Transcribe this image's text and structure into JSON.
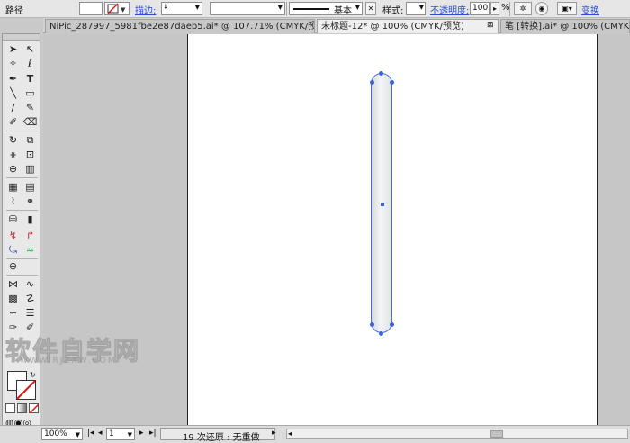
{
  "control_bar": {
    "path_label": "路径",
    "stroke_label": "描边:",
    "stroke_weight_value": "",
    "brush_label": "基本",
    "style_label": "样式:",
    "opacity_label": "不透明度:",
    "opacity_value": "100",
    "opacity_unit": "%",
    "transform_label": "变换"
  },
  "tabs": [
    {
      "label": "NiPic_287997_5981fbe2e87daeb5.ai* @ 107.71% (CMYK/预览)",
      "active": false
    },
    {
      "label": "未标题-12* @ 100% (CMYK/预览)",
      "active": true
    },
    {
      "label": "笔 [转换].ai* @ 100% (CMYK/预览)",
      "active": false
    }
  ],
  "watermark": {
    "main": "软件自学网",
    "sub": "WWW.RJZXW.COM"
  },
  "status_bar": {
    "zoom_value": "100%",
    "page_value": "1",
    "history_text": "19 次还原 : 无重做"
  },
  "colors": {
    "selection": "#3d63d6",
    "link": "#2a4fd6",
    "artboard": "#ffffff",
    "pasteboard": "#c6c6c6"
  },
  "icons": {
    "tools": [
      "selection-arrow",
      "direct-selection-arrow",
      "magic-wand",
      "lasso",
      "pen",
      "type",
      "line-segment",
      "rectangle",
      "paintbrush",
      "pencil",
      "blob-brush",
      "eraser",
      "rotate",
      "scale",
      "warp",
      "free-transform",
      "shape-builder",
      "live-paint",
      "perspective-grid",
      "mesh",
      "gradient",
      "eyedropper",
      "blend",
      "symbol-sprayer",
      "column-graph",
      "artboard",
      "slice",
      "hand",
      "zoom"
    ]
  }
}
